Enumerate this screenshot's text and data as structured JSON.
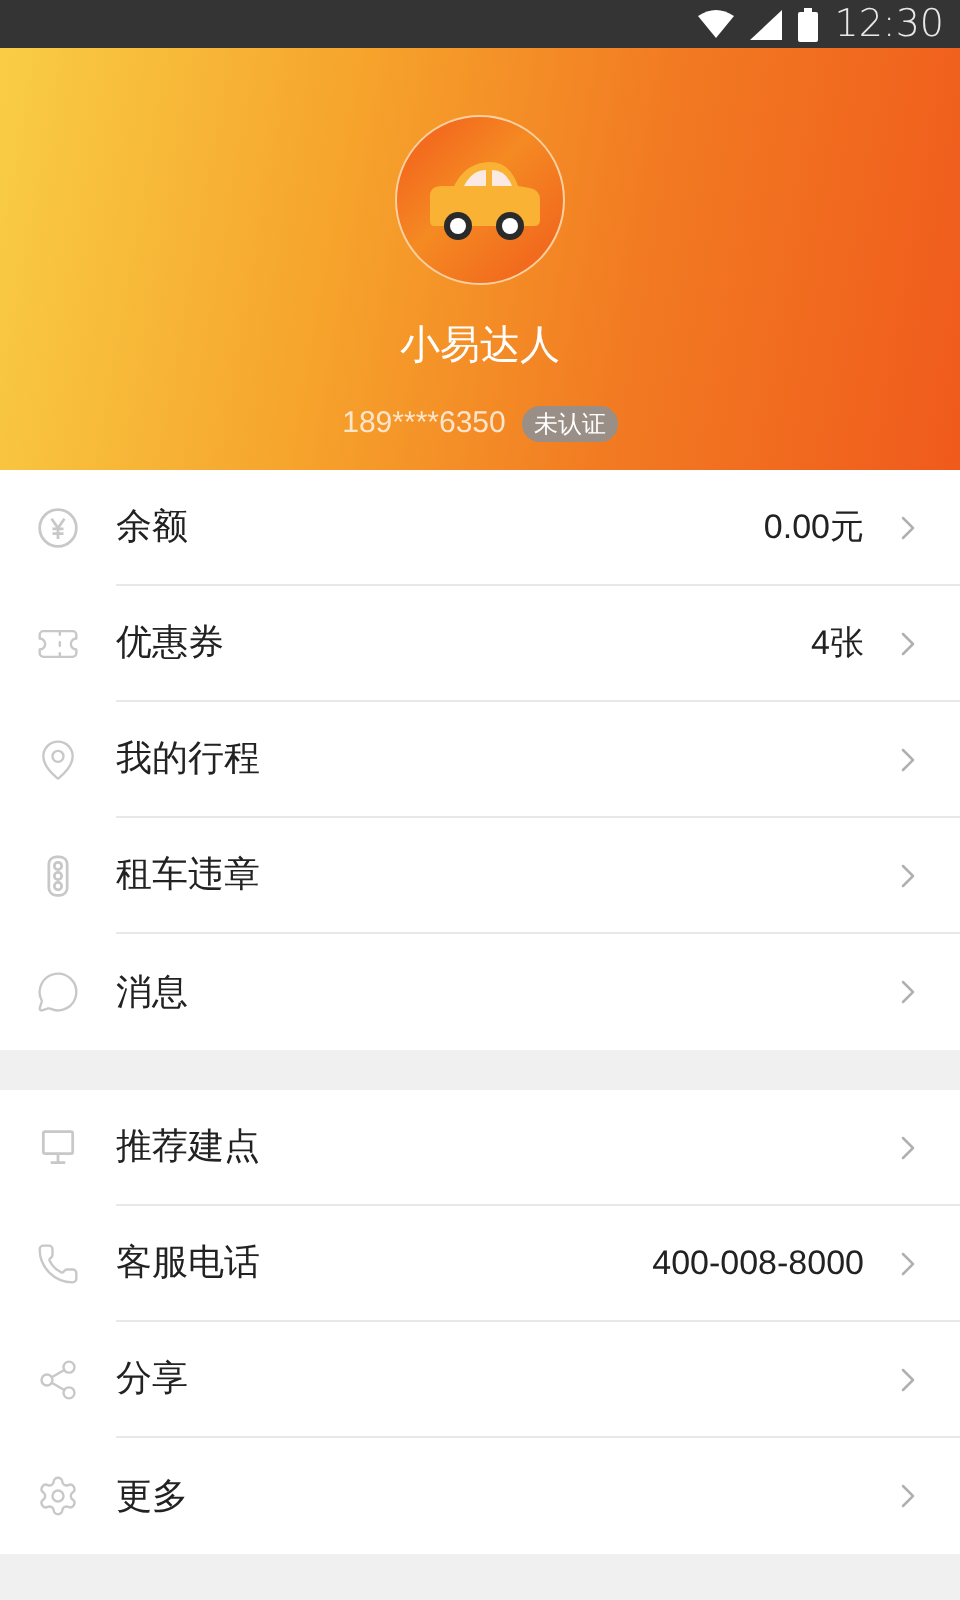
{
  "status_bar": {
    "time": "12:30"
  },
  "profile": {
    "name": "小易达人",
    "phone": "189****6350",
    "badge": "未认证"
  },
  "groups": [
    {
      "items": [
        {
          "label": "余额",
          "value": "0.00元"
        },
        {
          "label": "优惠券",
          "value": "4张"
        },
        {
          "label": "我的行程"
        },
        {
          "label": "租车违章"
        },
        {
          "label": "消息"
        }
      ]
    },
    {
      "items": [
        {
          "label": "推荐建点"
        },
        {
          "label": "客服电话",
          "value": "400-008-8000"
        },
        {
          "label": "分享"
        },
        {
          "label": "更多"
        }
      ]
    }
  ]
}
